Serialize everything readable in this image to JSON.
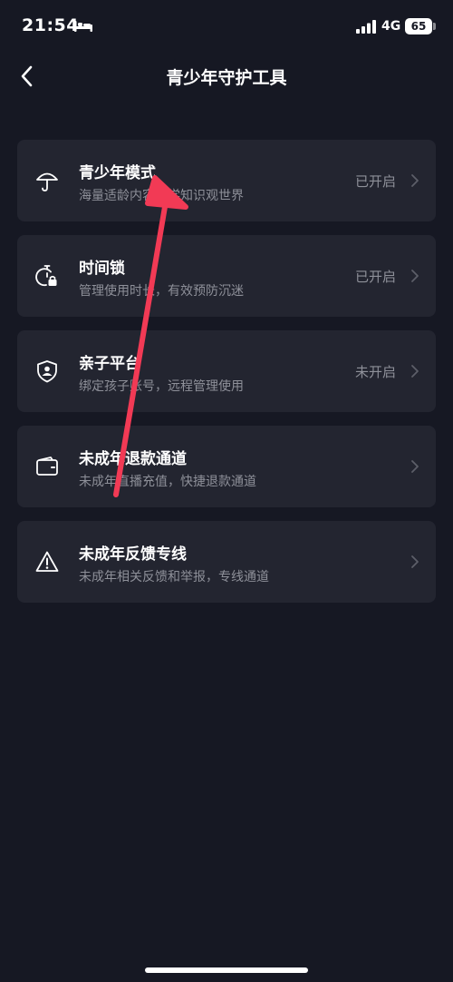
{
  "status_bar": {
    "time": "21:54",
    "network": "4G",
    "battery": "65",
    "sleep_icon": "bed-icon",
    "signal_icon": "signal-bars-icon"
  },
  "header": {
    "title": "青少年守护工具",
    "back_icon": "back-chevron-icon"
  },
  "items": [
    {
      "icon": "umbrella-icon",
      "title": "青少年模式",
      "subtitle": "海量适龄内容，学知识观世界",
      "status": "已开启"
    },
    {
      "icon": "time-lock-icon",
      "title": "时间锁",
      "subtitle": "管理使用时长，有效预防沉迷",
      "status": "已开启"
    },
    {
      "icon": "parent-shield-icon",
      "title": "亲子平台",
      "subtitle": "绑定孩子账号，远程管理使用",
      "status": "未开启"
    },
    {
      "icon": "wallet-icon",
      "title": "未成年退款通道",
      "subtitle": "未成年直播充值，快捷退款通道",
      "status": ""
    },
    {
      "icon": "warning-icon",
      "title": "未成年反馈专线",
      "subtitle": "未成年相关反馈和举报，专线通道",
      "status": ""
    }
  ],
  "colors": {
    "background": "#161823",
    "card": "#232530",
    "secondary_text": "#8e9099",
    "annotation_arrow": "#f23a55"
  }
}
